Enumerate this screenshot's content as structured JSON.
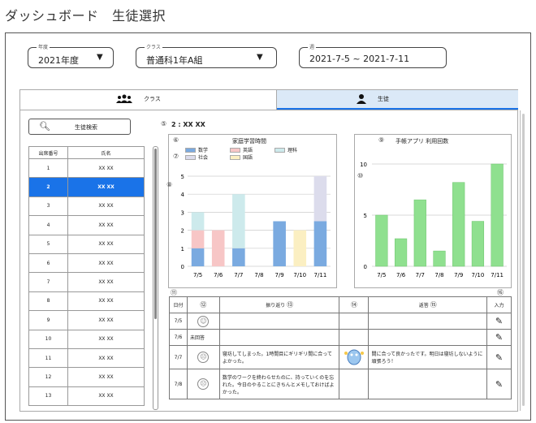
{
  "page_title": "ダッシュボード　生徒選択",
  "filters": {
    "year": {
      "label": "年度",
      "value": "2021年度",
      "arrow": "▼"
    },
    "class": {
      "label": "クラス",
      "value": "普通科1年A組",
      "arrow": "▼"
    },
    "week": {
      "label": "週",
      "value": "2021-7-5 ~ 2021-7-11"
    }
  },
  "tabs": {
    "class": {
      "label": "クラス",
      "icon": "group-icon"
    },
    "student": {
      "label": "生徒",
      "icon": "person-icon"
    }
  },
  "search_button": {
    "label": "生徒検索",
    "icon": "search-icon"
  },
  "student_table": {
    "headers": [
      "出席番号",
      "氏名"
    ],
    "rows": [
      {
        "no": "1",
        "name": "XX XX"
      },
      {
        "no": "2",
        "name": "XX XX"
      },
      {
        "no": "3",
        "name": "XX XX"
      },
      {
        "no": "4",
        "name": "XX XX"
      },
      {
        "no": "5",
        "name": "XX XX"
      },
      {
        "no": "6",
        "name": "XX XX"
      },
      {
        "no": "7",
        "name": "XX XX"
      },
      {
        "no": "8",
        "name": "XX XX"
      },
      {
        "no": "9",
        "name": "XX XX"
      },
      {
        "no": "10",
        "name": "XX XX"
      },
      {
        "no": "11",
        "name": "XX XX"
      },
      {
        "no": "12",
        "name": "XX XX"
      },
      {
        "no": "13",
        "name": "XX XX"
      }
    ],
    "selected_index": 1
  },
  "selected_student": {
    "marker": "⑤",
    "text": "2 : XX XX"
  },
  "markers": {
    "m6": "⑥",
    "m7": "⑦",
    "m8": "⑧",
    "m9": "⑨",
    "m10": "⑩",
    "m11": "⑪",
    "m12": "⑫",
    "m13": "⑬",
    "m14": "⑭",
    "m15": "⑮",
    "m16": "⑯"
  },
  "chart_data": [
    {
      "type": "bar",
      "title": "家庭学習時間",
      "stacked": true,
      "categories": [
        "7/5",
        "7/6",
        "7/7",
        "7/8",
        "7/9",
        "7/10",
        "7/11"
      ],
      "series": [
        {
          "name": "数学",
          "color": "#7aaae0",
          "values": [
            1,
            0,
            1,
            0,
            2.5,
            0,
            2.5
          ]
        },
        {
          "name": "英語",
          "color": "#f7c6c6",
          "values": [
            1,
            2,
            0,
            0,
            0,
            0,
            0
          ]
        },
        {
          "name": "理科",
          "color": "#cdeaec",
          "values": [
            1,
            0,
            3,
            0,
            0,
            0,
            0
          ]
        },
        {
          "name": "社会",
          "color": "#dcdcec",
          "values": [
            0,
            0,
            0,
            0,
            0,
            0,
            2.5
          ]
        },
        {
          "name": "国語",
          "color": "#fbefc2",
          "values": [
            0,
            0,
            0,
            0,
            0,
            2,
            0
          ]
        }
      ],
      "yticks": [
        "0",
        "1",
        "2",
        "3",
        "4",
        "5"
      ],
      "ylim": [
        0,
        5
      ],
      "grid": true,
      "legend": "top"
    },
    {
      "type": "bar",
      "title": "手帳アプリ 利用回数",
      "categories": [
        "7/5",
        "7/6",
        "7/7",
        "7/8",
        "7/9",
        "7/10",
        "7/11"
      ],
      "values": [
        5,
        2.7,
        6.5,
        1.5,
        8.2,
        4.4,
        10
      ],
      "color": "#8fe08f",
      "yticks": [
        "0",
        "5",
        "10"
      ],
      "ylim": [
        0,
        10
      ],
      "grid": true
    }
  ],
  "reflection_table": {
    "headers": {
      "date": "日付",
      "reflection": "振り返り",
      "reply": "返答",
      "input": "入力"
    },
    "rows": [
      {
        "date": "7/5",
        "face": "smile",
        "status": "",
        "reflection": "",
        "reply": "",
        "has_avatar": false
      },
      {
        "date": "7/6",
        "face": "none",
        "status": "未回答",
        "reflection": "",
        "reply": "",
        "has_avatar": false
      },
      {
        "date": "7/7",
        "face": "sad",
        "status": "",
        "reflection": "寝坊してしまった。1時間目にギリギリ間に合ってよかった。",
        "reply": "間に合って良かったです。明日は寝坊しないように頑張ろう！",
        "has_avatar": true
      },
      {
        "date": "7/8",
        "face": "sad",
        "status": "",
        "reflection": "数学のワークを終わらせたのに、持っていくのを忘れた。今日のやることにきちんとメモしておけばよかった。",
        "reply": "",
        "has_avatar": false
      }
    ]
  }
}
